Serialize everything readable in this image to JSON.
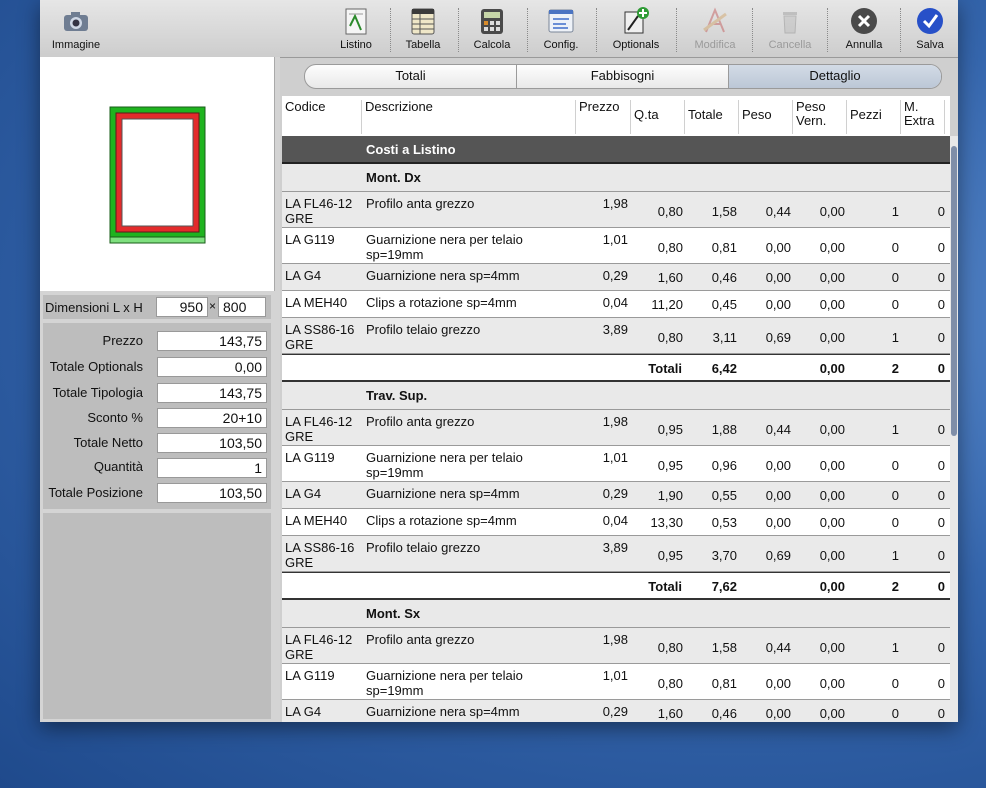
{
  "toolbar": {
    "immagine": "Immagine",
    "listino": "Listino",
    "tabella": "Tabella",
    "calcola": "Calcola",
    "config": "Config.",
    "optionals": "Optionals",
    "modifica": "Modifica",
    "cancella": "Cancella",
    "annulla": "Annulla",
    "salva": "Salva"
  },
  "left": {
    "dim_label": "Dimensioni L x H",
    "width": "950",
    "x_sep": "×",
    "height": "800",
    "summary": [
      {
        "label": "Prezzo",
        "value": "143,75"
      },
      {
        "label": "Totale Optionals",
        "value": "0,00"
      },
      {
        "label": "Totale Tipologia",
        "value": "143,75"
      },
      {
        "label": "Sconto %",
        "value": "20+10"
      },
      {
        "label": "Totale Netto",
        "value": "103,50"
      },
      {
        "label": "Quantità",
        "value": "1"
      },
      {
        "label": "Totale Posizione",
        "value": "103,50"
      }
    ]
  },
  "tabs": [
    {
      "label": "Totali",
      "selected": false
    },
    {
      "label": "Fabbisogni",
      "selected": false
    },
    {
      "label": "Dettaglio",
      "selected": true
    }
  ],
  "columns": [
    "Codice",
    "Descrizione",
    "Prezzo",
    "Q.ta",
    "Totale",
    "Peso",
    "Peso Vern.",
    "Pezzi",
    "M. Extra"
  ],
  "section_title": "Costi a Listino",
  "groups": [
    {
      "name": "Mont. Dx",
      "rows": [
        {
          "codice": "LA FL46-12 GRE",
          "descrizione": "Profilo anta grezzo",
          "prezzo": "1,98",
          "qta": "0,80",
          "totale": "1,58",
          "peso": "0,44",
          "peso_vern": "0,00",
          "pezzi": "1",
          "extra": "0"
        },
        {
          "codice": "LA G119",
          "descrizione": "Guarnizione nera per telaio sp=19mm",
          "prezzo": "1,01",
          "qta": "0,80",
          "totale": "0,81",
          "peso": "0,00",
          "peso_vern": "0,00",
          "pezzi": "0",
          "extra": "0"
        },
        {
          "codice": "LA G4",
          "descrizione": "Guarnizione nera sp=4mm",
          "prezzo": "0,29",
          "qta": "1,60",
          "totale": "0,46",
          "peso": "0,00",
          "peso_vern": "0,00",
          "pezzi": "0",
          "extra": "0"
        },
        {
          "codice": "LA MEH40",
          "descrizione": "Clips a rotazione sp=4mm",
          "prezzo": "0,04",
          "qta": "11,20",
          "totale": "0,45",
          "peso": "0,00",
          "peso_vern": "0,00",
          "pezzi": "0",
          "extra": "0"
        },
        {
          "codice": "LA SS86-16 GRE",
          "descrizione": "Profilo telaio grezzo",
          "prezzo": "3,89",
          "qta": "0,80",
          "totale": "3,11",
          "peso": "0,69",
          "peso_vern": "0,00",
          "pezzi": "1",
          "extra": "0"
        }
      ],
      "totals": {
        "label": "Totali",
        "totale": "6,42",
        "peso_vern": "0,00",
        "pezzi": "2",
        "extra": "0"
      }
    },
    {
      "name": "Trav. Sup.",
      "rows": [
        {
          "codice": "LA FL46-12 GRE",
          "descrizione": "Profilo anta grezzo",
          "prezzo": "1,98",
          "qta": "0,95",
          "totale": "1,88",
          "peso": "0,44",
          "peso_vern": "0,00",
          "pezzi": "1",
          "extra": "0"
        },
        {
          "codice": "LA G119",
          "descrizione": "Guarnizione nera per telaio sp=19mm",
          "prezzo": "1,01",
          "qta": "0,95",
          "totale": "0,96",
          "peso": "0,00",
          "peso_vern": "0,00",
          "pezzi": "0",
          "extra": "0"
        },
        {
          "codice": "LA G4",
          "descrizione": "Guarnizione nera sp=4mm",
          "prezzo": "0,29",
          "qta": "1,90",
          "totale": "0,55",
          "peso": "0,00",
          "peso_vern": "0,00",
          "pezzi": "0",
          "extra": "0"
        },
        {
          "codice": "LA MEH40",
          "descrizione": "Clips a rotazione sp=4mm",
          "prezzo": "0,04",
          "qta": "13,30",
          "totale": "0,53",
          "peso": "0,00",
          "peso_vern": "0,00",
          "pezzi": "0",
          "extra": "0"
        },
        {
          "codice": "LA SS86-16 GRE",
          "descrizione": "Profilo telaio grezzo",
          "prezzo": "3,89",
          "qta": "0,95",
          "totale": "3,70",
          "peso": "0,69",
          "peso_vern": "0,00",
          "pezzi": "1",
          "extra": "0"
        }
      ],
      "totals": {
        "label": "Totali",
        "totale": "7,62",
        "peso_vern": "0,00",
        "pezzi": "2",
        "extra": "0"
      }
    },
    {
      "name": "Mont. Sx",
      "rows": [
        {
          "codice": "LA FL46-12 GRE",
          "descrizione": "Profilo anta grezzo",
          "prezzo": "1,98",
          "qta": "0,80",
          "totale": "1,58",
          "peso": "0,44",
          "peso_vern": "0,00",
          "pezzi": "1",
          "extra": "0"
        },
        {
          "codice": "LA G119",
          "descrizione": "Guarnizione nera per telaio sp=19mm",
          "prezzo": "1,01",
          "qta": "0,80",
          "totale": "0,81",
          "peso": "0,00",
          "peso_vern": "0,00",
          "pezzi": "0",
          "extra": "0"
        },
        {
          "codice": "LA G4",
          "descrizione": "Guarnizione nera sp=4mm",
          "prezzo": "0,29",
          "qta": "1,60",
          "totale": "0,46",
          "peso": "0,00",
          "peso_vern": "0,00",
          "pezzi": "0",
          "extra": "0"
        }
      ]
    }
  ]
}
